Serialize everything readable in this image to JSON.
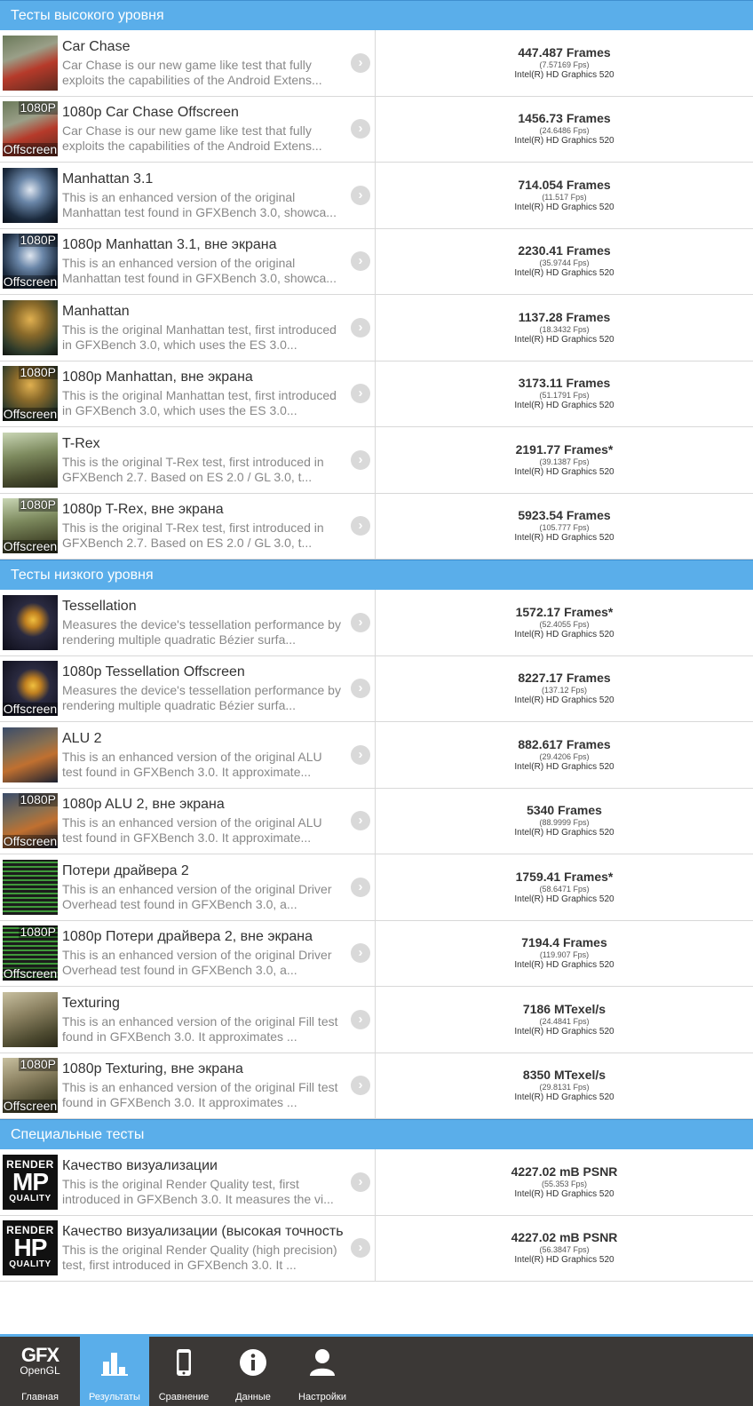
{
  "sections": [
    {
      "title": "Тесты высокого уровня",
      "tests": [
        {
          "name": "Car Chase",
          "desc": "Car Chase is our new game like test that fully exploits the capabilities of the Android Extens...",
          "score": "447.487 Frames",
          "fps": "(7.57169 Fps)",
          "device": "Intel(R) HD Graphics 520",
          "thumb": "carchase",
          "tag_top": "",
          "tag_bot": ""
        },
        {
          "name": "1080p Car Chase Offscreen",
          "desc": "Car Chase is our new game like test that fully exploits the capabilities of the Android Extens...",
          "score": "1456.73 Frames",
          "fps": "(24.6486 Fps)",
          "device": "Intel(R) HD Graphics 520",
          "thumb": "carchase",
          "tag_top": "1080P",
          "tag_bot": "Offscreen"
        },
        {
          "name": "Manhattan 3.1",
          "desc": "This is an enhanced version of the original Manhattan test found in GFXBench 3.0, showca...",
          "score": "714.054 Frames",
          "fps": "(11.517 Fps)",
          "device": "Intel(R) HD Graphics 520",
          "thumb": "manhattan31",
          "tag_top": "",
          "tag_bot": ""
        },
        {
          "name": "1080p Manhattan 3.1, вне экрана",
          "desc": "This is an enhanced version of the original Manhattan test found in GFXBench 3.0, showca...",
          "score": "2230.41 Frames",
          "fps": "(35.9744 Fps)",
          "device": "Intel(R) HD Graphics 520",
          "thumb": "manhattan31",
          "tag_top": "1080P",
          "tag_bot": "Offscreen"
        },
        {
          "name": "Manhattan",
          "desc": "This is the original Manhattan test, first introduced in GFXBench 3.0, which uses the ES 3.0...",
          "score": "1137.28 Frames",
          "fps": "(18.3432 Fps)",
          "device": "Intel(R) HD Graphics 520",
          "thumb": "manhattan",
          "tag_top": "",
          "tag_bot": ""
        },
        {
          "name": "1080p Manhattan, вне экрана",
          "desc": "This is the original Manhattan test, first introduced in GFXBench 3.0, which uses the ES 3.0...",
          "score": "3173.11 Frames",
          "fps": "(51.1791 Fps)",
          "device": "Intel(R) HD Graphics 520",
          "thumb": "manhattan",
          "tag_top": "1080P",
          "tag_bot": "Offscreen"
        },
        {
          "name": "T-Rex",
          "desc": "This is the original T-Rex test, first introduced in GFXBench 2.7. Based on ES 2.0 / GL 3.0, t...",
          "score": "2191.77 Frames*",
          "fps": "(39.1387 Fps)",
          "device": "Intel(R) HD Graphics 520",
          "thumb": "trex",
          "tag_top": "",
          "tag_bot": ""
        },
        {
          "name": "1080p T-Rex, вне экрана",
          "desc": "This is the original T-Rex test, first introduced in GFXBench 2.7. Based on ES 2.0 / GL 3.0, t...",
          "score": "5923.54 Frames",
          "fps": "(105.777 Fps)",
          "device": "Intel(R) HD Graphics 520",
          "thumb": "trex",
          "tag_top": "1080P",
          "tag_bot": "Offscreen"
        }
      ]
    },
    {
      "title": "Тесты низкого уровня",
      "tests": [
        {
          "name": "Tessellation",
          "desc": "Measures the device's tessellation performance by rendering multiple quadratic Bézier surfa...",
          "score": "1572.17 Frames*",
          "fps": "(52.4055 Fps)",
          "device": "Intel(R) HD Graphics 520",
          "thumb": "tess",
          "tag_top": "",
          "tag_bot": ""
        },
        {
          "name": "1080p Tessellation Offscreen",
          "desc": "Measures the device's tessellation performance by rendering multiple quadratic Bézier surfa...",
          "score": "8227.17 Frames",
          "fps": "(137.12 Fps)",
          "device": "Intel(R) HD Graphics 520",
          "thumb": "tess",
          "tag_top": "",
          "tag_bot": "Offscreen"
        },
        {
          "name": "ALU 2",
          "desc": "This is an enhanced version of the original ALU test found in GFXBench 3.0. It approximate...",
          "score": "882.617 Frames",
          "fps": "(29.4206 Fps)",
          "device": "Intel(R) HD Graphics 520",
          "thumb": "alu",
          "tag_top": "",
          "tag_bot": ""
        },
        {
          "name": "1080p ALU 2, вне экрана",
          "desc": "This is an enhanced version of the original ALU test found in GFXBench 3.0. It approximate...",
          "score": "5340 Frames",
          "fps": "(88.9999 Fps)",
          "device": "Intel(R) HD Graphics 520",
          "thumb": "alu",
          "tag_top": "1080P",
          "tag_bot": "Offscreen"
        },
        {
          "name": "Потери драйвера 2",
          "desc": "This is an enhanced version of the original Driver Overhead test found in GFXBench 3.0, a...",
          "score": "1759.41 Frames*",
          "fps": "(58.6471 Fps)",
          "device": "Intel(R) HD Graphics 520",
          "thumb": "driver",
          "tag_top": "",
          "tag_bot": ""
        },
        {
          "name": "1080p Потери драйвера 2, вне экрана",
          "desc": "This is an enhanced version of the original Driver Overhead test found in GFXBench 3.0, a...",
          "score": "7194.4 Frames",
          "fps": "(119.907 Fps)",
          "device": "Intel(R) HD Graphics 520",
          "thumb": "driver",
          "tag_top": "1080P",
          "tag_bot": "Offscreen"
        },
        {
          "name": "Texturing",
          "desc": "This is an enhanced version of the original Fill test found in GFXBench 3.0. It approximates ...",
          "score": "7186 MTexel/s",
          "fps": "(24.4841 Fps)",
          "device": "Intel(R) HD Graphics 520",
          "thumb": "texturing",
          "tag_top": "",
          "tag_bot": ""
        },
        {
          "name": "1080p Texturing, вне экрана",
          "desc": "This is an enhanced version of the original Fill test found in GFXBench 3.0. It approximates ...",
          "score": "8350 MTexel/s",
          "fps": "(29.8131 Fps)",
          "device": "Intel(R) HD Graphics 520",
          "thumb": "texturing",
          "tag_top": "1080P",
          "tag_bot": "Offscreen"
        }
      ]
    },
    {
      "title": "Специальные тесты",
      "tests": [
        {
          "name": "Качество визуализации",
          "desc": "This is the original Render Quality test, first introduced in GFXBench 3.0. It measures the vi...",
          "score": "4227.02 mB PSNR",
          "fps": "(55.353 Fps)",
          "device": "Intel(R) HD Graphics 520",
          "thumb": "quality",
          "q_top": "RENDER",
          "q_mid": "MP",
          "q_bot": "QUALITY",
          "tag_top": "",
          "tag_bot": ""
        },
        {
          "name": "Качество визуализации (высокая точность)",
          "desc": "This is the original Render Quality (high precision) test, first introduced in GFXBench 3.0. It ...",
          "score": "4227.02 mB PSNR",
          "fps": "(56.3847 Fps)",
          "device": "Intel(R) HD Graphics 520",
          "thumb": "quality",
          "q_top": "RENDER",
          "q_mid": "HP",
          "q_bot": "QUALITY",
          "tag_top": "",
          "tag_bot": ""
        }
      ]
    }
  ],
  "tabbar": {
    "logo_main": "GFX",
    "logo_sub": "OpenGL",
    "tabs": [
      {
        "label": "Главная",
        "icon": "home-logo-icon",
        "active": false
      },
      {
        "label": "Результаты",
        "icon": "bar-chart-icon",
        "active": true
      },
      {
        "label": "Сравнение",
        "icon": "phone-icon",
        "active": false
      },
      {
        "label": "Данные",
        "icon": "info-icon",
        "active": false
      },
      {
        "label": "Настройки",
        "icon": "user-icon",
        "active": false
      }
    ]
  },
  "colors": {
    "accent": "#5aaeea",
    "tabbar_bg": "#3b3836"
  }
}
